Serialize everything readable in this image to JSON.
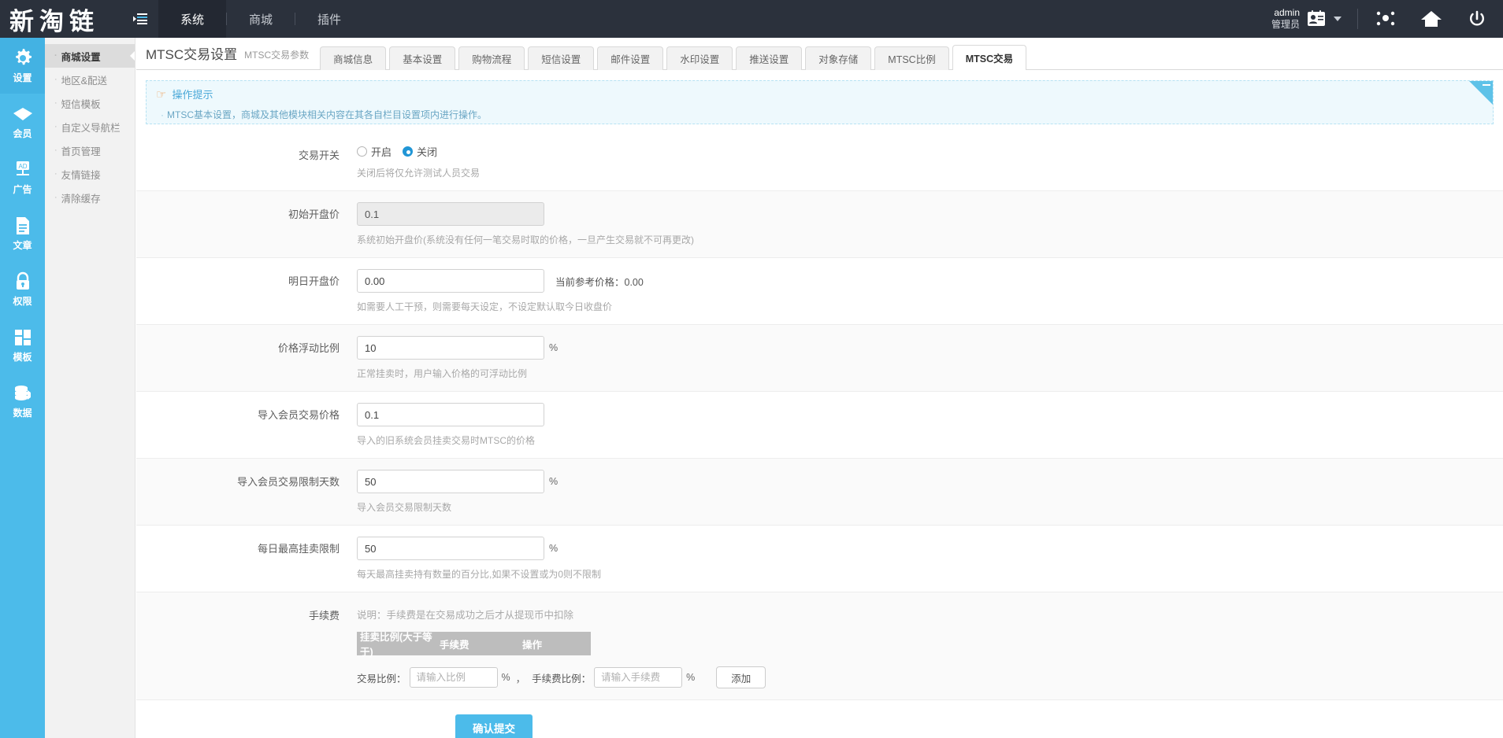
{
  "topbar": {
    "brand": "新淘链",
    "collapse_icon": "menu-collapse-icon",
    "nav": [
      {
        "label": "系统",
        "active": true
      },
      {
        "label": "商城",
        "active": false
      },
      {
        "label": "插件",
        "active": false
      }
    ],
    "user": {
      "name": "admin",
      "role": "管理员"
    },
    "icons": [
      "user-card-icon",
      "caret-down-icon",
      "nodes-icon",
      "home-icon",
      "power-icon"
    ]
  },
  "rail": [
    {
      "label": "设置",
      "icon": "gear-icon",
      "active": true
    },
    {
      "label": "会员",
      "icon": "diamond-icon",
      "active": false
    },
    {
      "label": "广告",
      "icon": "ad-icon",
      "active": false
    },
    {
      "label": "文章",
      "icon": "document-icon",
      "active": false
    },
    {
      "label": "权限",
      "icon": "lock-icon",
      "active": false
    },
    {
      "label": "模板",
      "icon": "grid-icon",
      "active": false
    },
    {
      "label": "数据",
      "icon": "database-icon",
      "active": false
    }
  ],
  "subnav": [
    {
      "label": "商城设置",
      "active": true
    },
    {
      "label": "地区&配送",
      "active": false
    },
    {
      "label": "短信模板",
      "active": false
    },
    {
      "label": "自定义导航栏",
      "active": false
    },
    {
      "label": "首页管理",
      "active": false
    },
    {
      "label": "友情链接",
      "active": false
    },
    {
      "label": "清除缓存",
      "active": false
    }
  ],
  "page": {
    "title": "MTSC交易设置",
    "subtitle": "MTSC交易参数"
  },
  "tabs": [
    {
      "label": "商城信息",
      "active": false
    },
    {
      "label": "基本设置",
      "active": false
    },
    {
      "label": "购物流程",
      "active": false
    },
    {
      "label": "短信设置",
      "active": false
    },
    {
      "label": "邮件设置",
      "active": false
    },
    {
      "label": "水印设置",
      "active": false
    },
    {
      "label": "推送设置",
      "active": false
    },
    {
      "label": "对象存储",
      "active": false
    },
    {
      "label": "MTSC比例",
      "active": false
    },
    {
      "label": "MTSC交易",
      "active": true
    }
  ],
  "notice": {
    "title": "操作提示",
    "bullet": "·",
    "text": "MTSC基本设置，商城及其他模块相关内容在其各自栏目设置项内进行操作。"
  },
  "form": {
    "trade_switch": {
      "label": "交易开关",
      "options": [
        {
          "label": "开启",
          "selected": false
        },
        {
          "label": "关闭",
          "selected": true
        }
      ],
      "hint": "关闭后将仅允许测试人员交易"
    },
    "initial_price": {
      "label": "初始开盘价",
      "value": "0.1",
      "hint": "系统初始开盘价(系统没有任何一笔交易时取的价格，一旦产生交易就不可再更改)"
    },
    "tomorrow_price": {
      "label": "明日开盘价",
      "value": "0.00",
      "aside": "当前参考价格：0.00",
      "hint": "如需要人工干预，则需要每天设定，不设定默认取今日收盘价"
    },
    "float_ratio": {
      "label": "价格浮动比例",
      "value": "10",
      "suffix": "%",
      "hint": "正常挂卖时，用户输入价格的可浮动比例"
    },
    "import_price": {
      "label": "导入会员交易价格",
      "value": "0.1",
      "hint": "导入的旧系统会员挂卖交易时MTSC的价格"
    },
    "import_limit_days": {
      "label": "导入会员交易限制天数",
      "value": "50",
      "suffix": "%",
      "hint": "导入会员交易限制天数"
    },
    "daily_max_sell": {
      "label": "每日最高挂卖限制",
      "value": "50",
      "suffix": "%",
      "hint": "每天最高挂卖持有数量的百分比,如果不设置或为0则不限制"
    },
    "fee": {
      "label": "手续费",
      "desc": "说明：手续费是在交易成功之后才从提现币中扣除",
      "columns": [
        "挂卖比例(大于等于)",
        "手续费",
        "操作"
      ],
      "rows": [],
      "add": {
        "ratio_label": "交易比例：",
        "ratio_placeholder": "请输入比例",
        "pct1": "%",
        "comma": "，",
        "fee_label": "手续费比例：",
        "fee_placeholder": "请输入手续费",
        "pct2": "%",
        "button": "添加"
      }
    },
    "submit": "确认提交"
  },
  "colors": {
    "accent": "#4cbbea",
    "topbar": "#2b313c",
    "notice_bg": "#eef9fd",
    "notice_border": "#b6e2f3",
    "table_header": "#bdbdbd"
  }
}
